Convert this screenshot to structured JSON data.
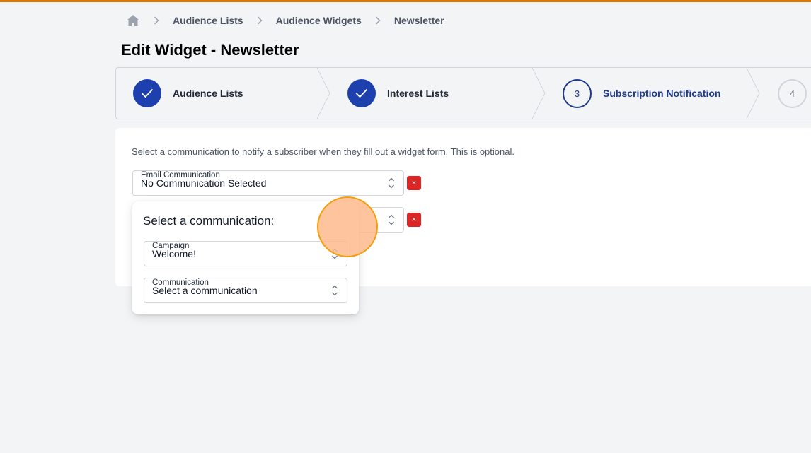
{
  "breadcrumb": {
    "home_icon": "home-icon",
    "items": [
      "Audience Lists",
      "Audience Widgets",
      "Newsletter"
    ]
  },
  "page_title": "Edit Widget - Newsletter",
  "stepper": {
    "steps": [
      {
        "label": "Audience Lists",
        "state": "complete"
      },
      {
        "label": "Interest Lists",
        "state": "complete"
      },
      {
        "number": "3",
        "label": "Subscription Notification",
        "state": "current"
      },
      {
        "number": "4",
        "label": "",
        "state": "upcoming"
      }
    ]
  },
  "notification": {
    "description": "Select a communication to notify a subscriber when they fill out a widget form. This is optional.",
    "email_communication": {
      "label": "Email Communication",
      "value": "No Communication Selected"
    },
    "remove_label": "×"
  },
  "popover": {
    "title": "Select a communication:",
    "campaign": {
      "label": "Campaign",
      "value": "Welcome!"
    },
    "communication": {
      "label": "Communication",
      "value": "Select a communication"
    }
  },
  "colors": {
    "accent": "#d97706",
    "primary": "#1e40af",
    "danger": "#dc2626",
    "cursor_highlight": "#fdba8c"
  }
}
